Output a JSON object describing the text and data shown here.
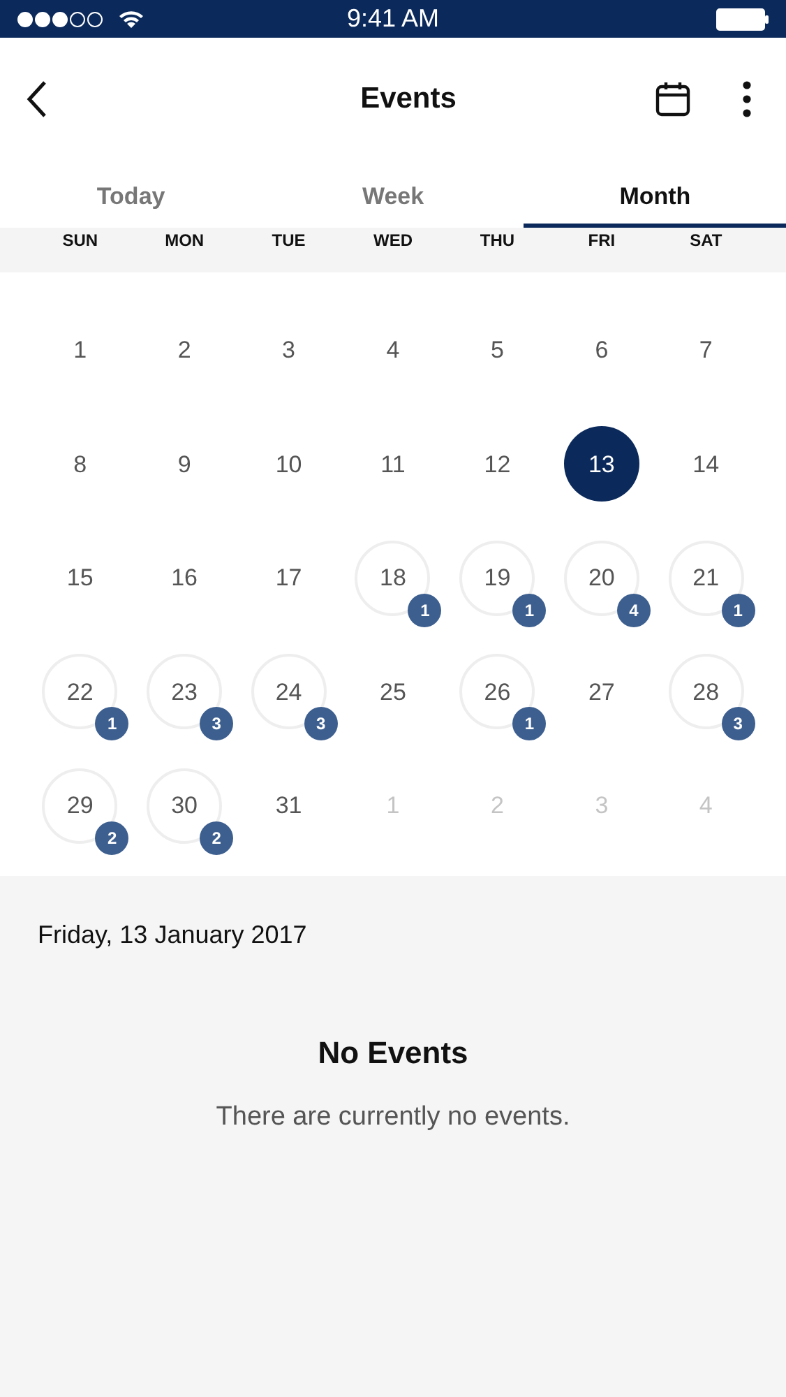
{
  "status_bar": {
    "time": "9:41 AM"
  },
  "header": {
    "title": "Events"
  },
  "tabs": [
    {
      "label": "Today",
      "selected": false
    },
    {
      "label": "Week",
      "selected": false
    },
    {
      "label": "Month",
      "selected": true
    }
  ],
  "weekdays": [
    "SUN",
    "MON",
    "TUE",
    "WED",
    "THU",
    "FRI",
    "SAT"
  ],
  "days": [
    {
      "day": "1",
      "outside": false,
      "selected": false
    },
    {
      "day": "2",
      "outside": false,
      "selected": false
    },
    {
      "day": "3",
      "outside": false,
      "selected": false
    },
    {
      "day": "4",
      "outside": false,
      "selected": false
    },
    {
      "day": "5",
      "outside": false,
      "selected": false
    },
    {
      "day": "6",
      "outside": false,
      "selected": false
    },
    {
      "day": "7",
      "outside": false,
      "selected": false
    },
    {
      "day": "8",
      "outside": false,
      "selected": false
    },
    {
      "day": "9",
      "outside": false,
      "selected": false
    },
    {
      "day": "10",
      "outside": false,
      "selected": false
    },
    {
      "day": "11",
      "outside": false,
      "selected": false
    },
    {
      "day": "12",
      "outside": false,
      "selected": false
    },
    {
      "day": "13",
      "outside": false,
      "selected": true
    },
    {
      "day": "14",
      "outside": false,
      "selected": false
    },
    {
      "day": "15",
      "outside": false,
      "selected": false
    },
    {
      "day": "16",
      "outside": false,
      "selected": false
    },
    {
      "day": "17",
      "outside": false,
      "selected": false
    },
    {
      "day": "18",
      "outside": false,
      "selected": false,
      "events": "1"
    },
    {
      "day": "19",
      "outside": false,
      "selected": false,
      "events": "1"
    },
    {
      "day": "20",
      "outside": false,
      "selected": false,
      "events": "4"
    },
    {
      "day": "21",
      "outside": false,
      "selected": false,
      "events": "1"
    },
    {
      "day": "22",
      "outside": false,
      "selected": false,
      "events": "1"
    },
    {
      "day": "23",
      "outside": false,
      "selected": false,
      "events": "3"
    },
    {
      "day": "24",
      "outside": false,
      "selected": false,
      "events": "3"
    },
    {
      "day": "25",
      "outside": false,
      "selected": false
    },
    {
      "day": "26",
      "outside": false,
      "selected": false,
      "events": "1"
    },
    {
      "day": "27",
      "outside": false,
      "selected": false
    },
    {
      "day": "28",
      "outside": false,
      "selected": false,
      "events": "3"
    },
    {
      "day": "29",
      "outside": false,
      "selected": false,
      "events": "2"
    },
    {
      "day": "30",
      "outside": false,
      "selected": false,
      "events": "2"
    },
    {
      "day": "31",
      "outside": false,
      "selected": false
    },
    {
      "day": "1",
      "outside": true,
      "selected": false
    },
    {
      "day": "2",
      "outside": true,
      "selected": false
    },
    {
      "day": "3",
      "outside": true,
      "selected": false
    },
    {
      "day": "4",
      "outside": true,
      "selected": false
    }
  ],
  "selected_date": "Friday, 13 January 2017",
  "empty_state": {
    "title": "No Events",
    "message": "There are currently no events."
  }
}
